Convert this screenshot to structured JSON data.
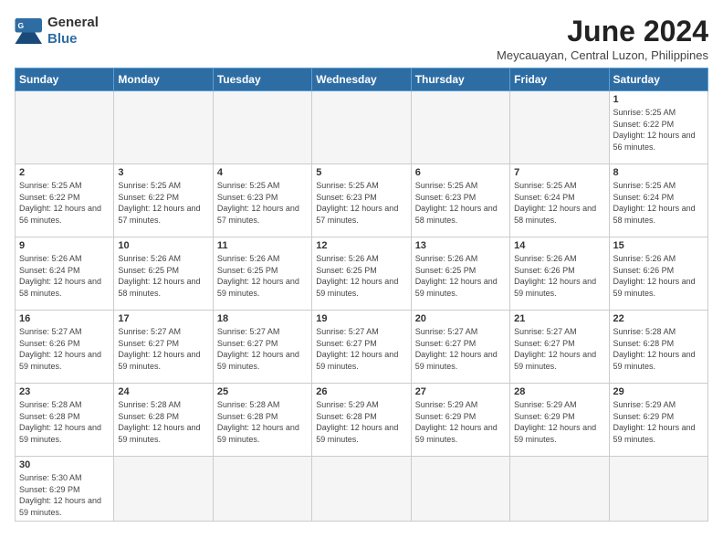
{
  "header": {
    "logo_line1": "General",
    "logo_line2": "Blue",
    "title": "June 2024",
    "subtitle": "Meycauayan, Central Luzon, Philippines"
  },
  "columns": [
    "Sunday",
    "Monday",
    "Tuesday",
    "Wednesday",
    "Thursday",
    "Friday",
    "Saturday"
  ],
  "weeks": [
    [
      {
        "day": "",
        "info": ""
      },
      {
        "day": "",
        "info": ""
      },
      {
        "day": "",
        "info": ""
      },
      {
        "day": "",
        "info": ""
      },
      {
        "day": "",
        "info": ""
      },
      {
        "day": "",
        "info": ""
      },
      {
        "day": "1",
        "info": "Sunrise: 5:25 AM\nSunset: 6:22 PM\nDaylight: 12 hours and 56 minutes."
      }
    ],
    [
      {
        "day": "2",
        "info": "Sunrise: 5:25 AM\nSunset: 6:22 PM\nDaylight: 12 hours and 56 minutes."
      },
      {
        "day": "3",
        "info": "Sunrise: 5:25 AM\nSunset: 6:22 PM\nDaylight: 12 hours and 57 minutes."
      },
      {
        "day": "4",
        "info": "Sunrise: 5:25 AM\nSunset: 6:23 PM\nDaylight: 12 hours and 57 minutes."
      },
      {
        "day": "5",
        "info": "Sunrise: 5:25 AM\nSunset: 6:23 PM\nDaylight: 12 hours and 57 minutes."
      },
      {
        "day": "6",
        "info": "Sunrise: 5:25 AM\nSunset: 6:23 PM\nDaylight: 12 hours and 58 minutes."
      },
      {
        "day": "7",
        "info": "Sunrise: 5:25 AM\nSunset: 6:24 PM\nDaylight: 12 hours and 58 minutes."
      },
      {
        "day": "8",
        "info": "Sunrise: 5:25 AM\nSunset: 6:24 PM\nDaylight: 12 hours and 58 minutes."
      }
    ],
    [
      {
        "day": "9",
        "info": "Sunrise: 5:26 AM\nSunset: 6:24 PM\nDaylight: 12 hours and 58 minutes."
      },
      {
        "day": "10",
        "info": "Sunrise: 5:26 AM\nSunset: 6:25 PM\nDaylight: 12 hours and 58 minutes."
      },
      {
        "day": "11",
        "info": "Sunrise: 5:26 AM\nSunset: 6:25 PM\nDaylight: 12 hours and 59 minutes."
      },
      {
        "day": "12",
        "info": "Sunrise: 5:26 AM\nSunset: 6:25 PM\nDaylight: 12 hours and 59 minutes."
      },
      {
        "day": "13",
        "info": "Sunrise: 5:26 AM\nSunset: 6:25 PM\nDaylight: 12 hours and 59 minutes."
      },
      {
        "day": "14",
        "info": "Sunrise: 5:26 AM\nSunset: 6:26 PM\nDaylight: 12 hours and 59 minutes."
      },
      {
        "day": "15",
        "info": "Sunrise: 5:26 AM\nSunset: 6:26 PM\nDaylight: 12 hours and 59 minutes."
      }
    ],
    [
      {
        "day": "16",
        "info": "Sunrise: 5:27 AM\nSunset: 6:26 PM\nDaylight: 12 hours and 59 minutes."
      },
      {
        "day": "17",
        "info": "Sunrise: 5:27 AM\nSunset: 6:27 PM\nDaylight: 12 hours and 59 minutes."
      },
      {
        "day": "18",
        "info": "Sunrise: 5:27 AM\nSunset: 6:27 PM\nDaylight: 12 hours and 59 minutes."
      },
      {
        "day": "19",
        "info": "Sunrise: 5:27 AM\nSunset: 6:27 PM\nDaylight: 12 hours and 59 minutes."
      },
      {
        "day": "20",
        "info": "Sunrise: 5:27 AM\nSunset: 6:27 PM\nDaylight: 12 hours and 59 minutes."
      },
      {
        "day": "21",
        "info": "Sunrise: 5:27 AM\nSunset: 6:27 PM\nDaylight: 12 hours and 59 minutes."
      },
      {
        "day": "22",
        "info": "Sunrise: 5:28 AM\nSunset: 6:28 PM\nDaylight: 12 hours and 59 minutes."
      }
    ],
    [
      {
        "day": "23",
        "info": "Sunrise: 5:28 AM\nSunset: 6:28 PM\nDaylight: 12 hours and 59 minutes."
      },
      {
        "day": "24",
        "info": "Sunrise: 5:28 AM\nSunset: 6:28 PM\nDaylight: 12 hours and 59 minutes."
      },
      {
        "day": "25",
        "info": "Sunrise: 5:28 AM\nSunset: 6:28 PM\nDaylight: 12 hours and 59 minutes."
      },
      {
        "day": "26",
        "info": "Sunrise: 5:29 AM\nSunset: 6:28 PM\nDaylight: 12 hours and 59 minutes."
      },
      {
        "day": "27",
        "info": "Sunrise: 5:29 AM\nSunset: 6:29 PM\nDaylight: 12 hours and 59 minutes."
      },
      {
        "day": "28",
        "info": "Sunrise: 5:29 AM\nSunset: 6:29 PM\nDaylight: 12 hours and 59 minutes."
      },
      {
        "day": "29",
        "info": "Sunrise: 5:29 AM\nSunset: 6:29 PM\nDaylight: 12 hours and 59 minutes."
      }
    ],
    [
      {
        "day": "30",
        "info": "Sunrise: 5:30 AM\nSunset: 6:29 PM\nDaylight: 12 hours and 59 minutes."
      },
      {
        "day": "",
        "info": ""
      },
      {
        "day": "",
        "info": ""
      },
      {
        "day": "",
        "info": ""
      },
      {
        "day": "",
        "info": ""
      },
      {
        "day": "",
        "info": ""
      },
      {
        "day": "",
        "info": ""
      }
    ]
  ]
}
